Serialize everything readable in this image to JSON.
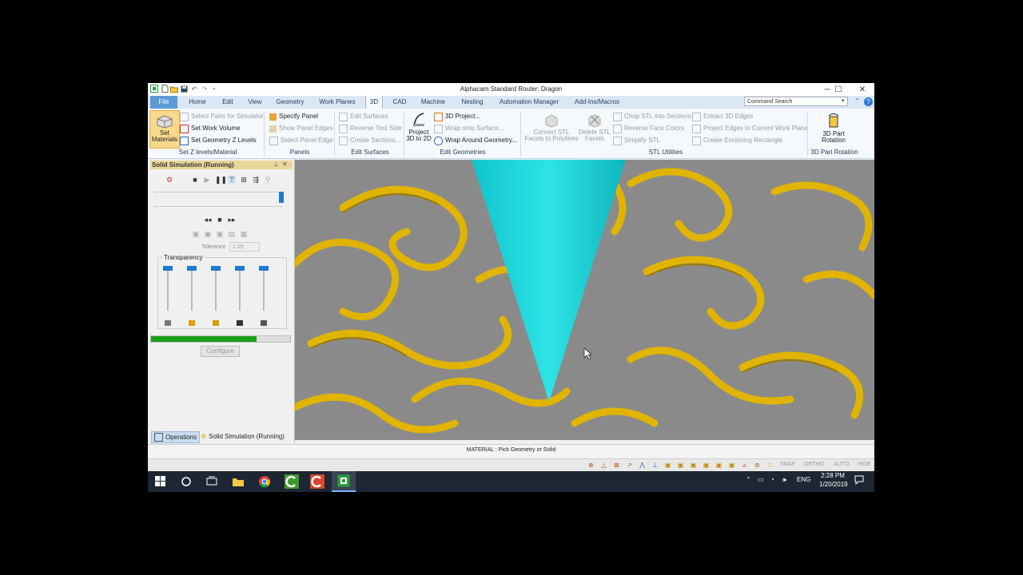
{
  "window": {
    "title": "Alphacam Standard Router: Dragon",
    "controls": [
      "minimize",
      "maximize",
      "close"
    ]
  },
  "tabs": [
    {
      "label": "File"
    },
    {
      "label": "Home"
    },
    {
      "label": "Edit"
    },
    {
      "label": "View"
    },
    {
      "label": "Geometry"
    },
    {
      "label": "Work Planes"
    },
    {
      "label": "3D",
      "active": true
    },
    {
      "label": "CAD"
    },
    {
      "label": "Machine"
    },
    {
      "label": "Nesting"
    },
    {
      "label": "Automation Manager"
    },
    {
      "label": "Add-Ins/Macros"
    }
  ],
  "command_search": {
    "placeholder": "Command Search"
  },
  "ribbon": {
    "set_materials": "Set Materials",
    "set_z": {
      "items": [
        "Select Parts for Simulator",
        "Set Work Volume",
        "Set Geometry Z Levels"
      ],
      "group": "Set Z levels/Material"
    },
    "panels": {
      "items": [
        "Specify Panel",
        "Show Panel Edges",
        "Select Panel Edge"
      ],
      "group": "Panels"
    },
    "surfaces": {
      "items": [
        "Edit Surfaces",
        "Reverse Tool Side",
        "Create Sections..."
      ],
      "group": "Edit Surfaces"
    },
    "project_3d_to_2d": "Project 3D to 2D",
    "edit_geometries": {
      "items": [
        "3D Project...",
        "Wrap onto Surface...",
        "Wrap Around Geometry..."
      ],
      "group": "Edit Geometries"
    },
    "convert_stl": "Convert STL Facets to Polylines",
    "delete_stl": "Delete STL Facets",
    "stl": {
      "items": [
        "Chop STL into Sections",
        "Reverse Face Colors",
        "Simplify STL"
      ],
      "group": "STL Utilities"
    },
    "edges": {
      "items": [
        "Extract 3D Edges",
        "Project Edges to Current Work Plane",
        "Create Enclosing Rectangle"
      ]
    },
    "part_rotation": {
      "button": "3D Part Rotation",
      "group": "3D Part Rotation"
    }
  },
  "panel": {
    "header": "Solid Simulation (Running)",
    "tolerance_label": "Tolerance",
    "tolerance_value": "1.25",
    "transparency_label": "Transparency",
    "transparency_levels": [
      0,
      0,
      0,
      0,
      0
    ],
    "progress": 0.76,
    "configure_label": "Configure",
    "bottom_tabs": [
      "Operations",
      "Solid Simulation (Running)"
    ]
  },
  "status": {
    "prompt": "MATERIAL : Pick Geometry or Solid",
    "toggles": [
      "SNAP",
      "ORTHO",
      "AUTO",
      "HIDE"
    ]
  },
  "taskbar": {
    "time": "2:28 PM",
    "date": "1/20/2019",
    "lang": "ENG"
  },
  "colors": {
    "tool": "#19d2d8",
    "material": "#e0b400",
    "viewport_bg": "#8a8a8a",
    "progress": "#1aa01a"
  }
}
